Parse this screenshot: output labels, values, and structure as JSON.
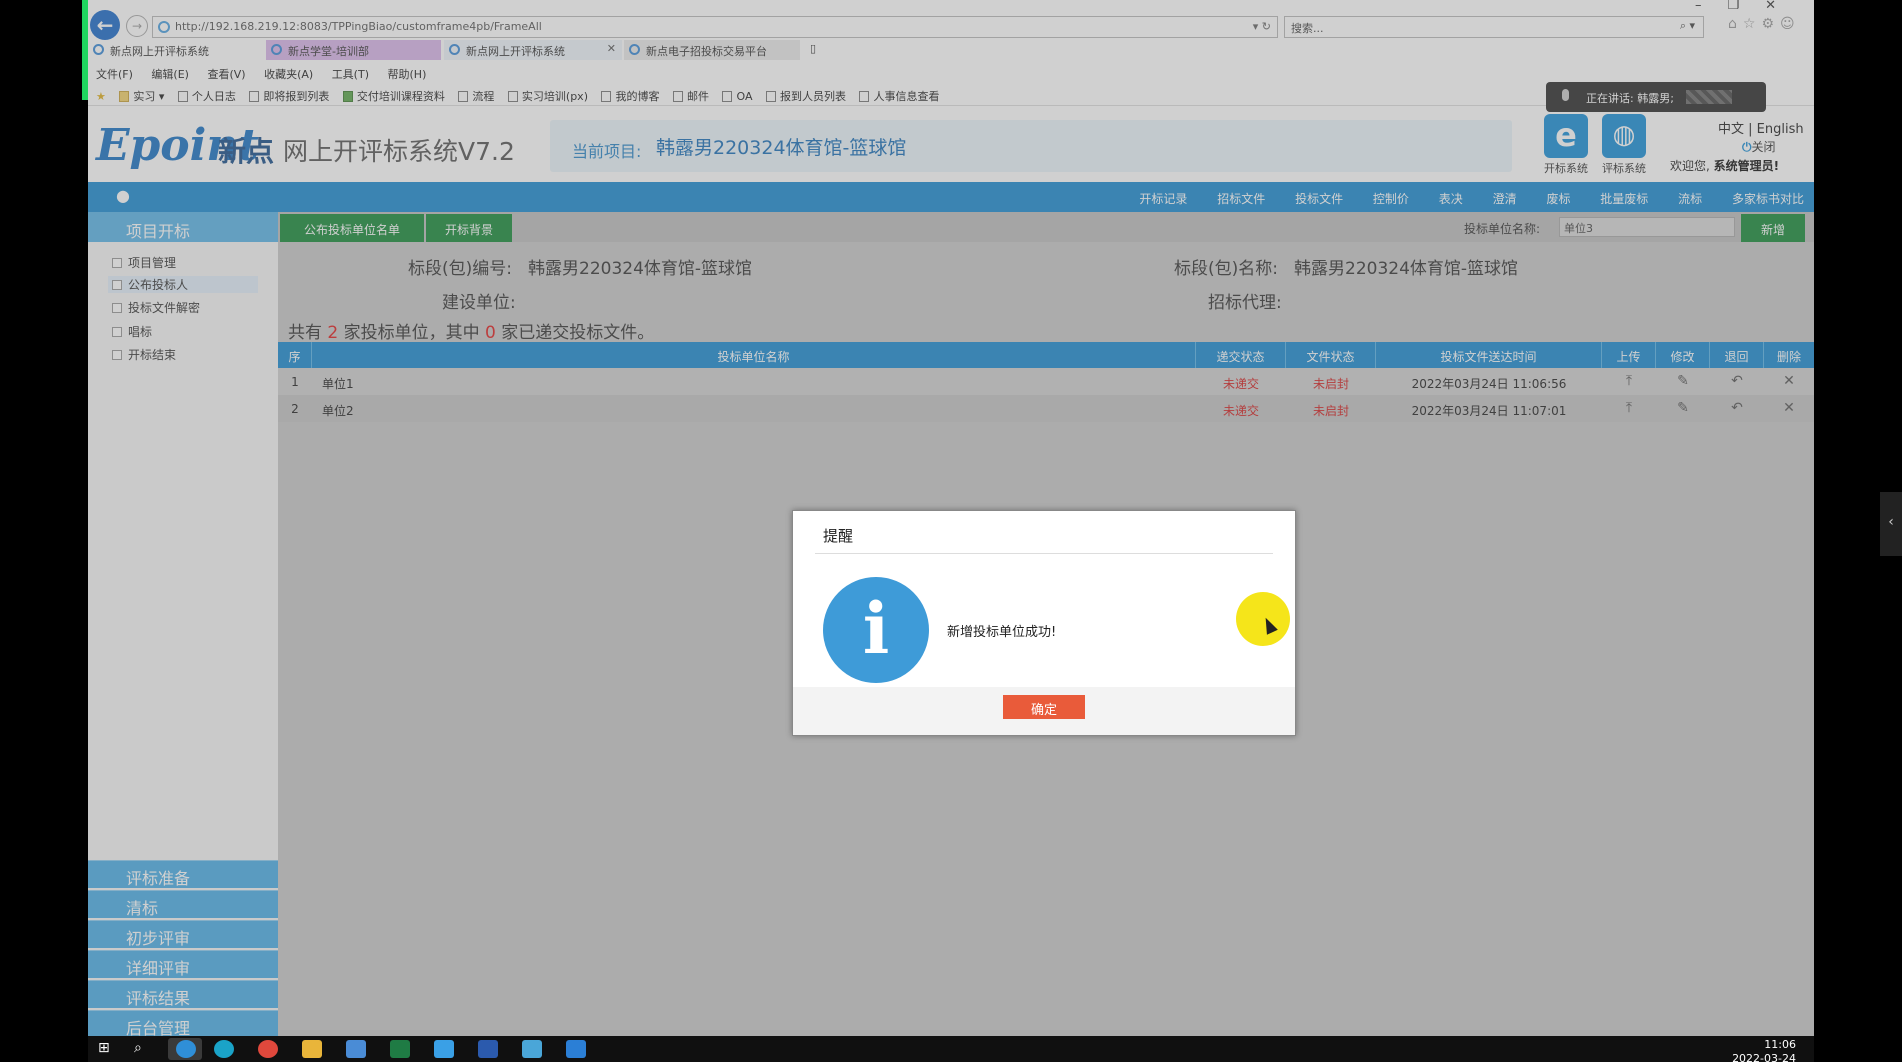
{
  "browser": {
    "url": "http://192.168.219.12:8083/TPPingBiao/customframe4pb/FrameAll",
    "search_placeholder": "搜索...",
    "tabs": [
      "新点网上开评标系统",
      "新点学堂-培训部",
      "新点网上开评标系统",
      "新点电子招投标交易平台"
    ],
    "menu": [
      "文件(F)",
      "编辑(E)",
      "查看(V)",
      "收藏夹(A)",
      "工具(T)",
      "帮助(H)"
    ],
    "favorites": [
      "实习",
      "个人日志",
      "即将报到列表",
      "交付培训课程资料",
      "流程",
      "实习培训(px)",
      "我的博客",
      "邮件",
      "OA",
      "报到人员列表",
      "人事信息查看"
    ],
    "speaking": "正在讲话: 韩露男;"
  },
  "header": {
    "logo_en": "Epoint",
    "logo_cn": "新点",
    "system_name": "网上开评标系统V7.2",
    "project_label": "当前项目:",
    "project_name": "韩露男220324体育馆-篮球馆",
    "sys_open": "开标系统",
    "sys_eval": "评标系统",
    "lang": "中文 | English",
    "close": "关闭",
    "welcome_prefix": "欢迎您,",
    "welcome_user": "系统管理员!"
  },
  "nav": [
    "开标记录",
    "招标文件",
    "投标文件",
    "控制价",
    "表决",
    "澄清",
    "废标",
    "批量废标",
    "流标",
    "多家标书对比"
  ],
  "sidebar": {
    "head": "项目开标",
    "items": [
      "项目管理",
      "公布投标人",
      "投标文件解密",
      "唱标",
      "开标结束"
    ],
    "sections": [
      "评标准备",
      "清标",
      "初步评审",
      "详细评审",
      "评标结果",
      "后台管理"
    ]
  },
  "toolbar": {
    "tab1": "公布投标单位名单",
    "tab2": "开标背景",
    "unit_label": "投标单位名称:",
    "unit_value": "单位3",
    "add": "新增"
  },
  "info": {
    "code_label": "标段(包)编号:",
    "code_value": "韩露男220324体育馆-篮球馆",
    "name_label": "标段(包)名称:",
    "name_value": "韩露男220324体育馆-篮球馆",
    "builder_label": "建设单位:",
    "agent_label": "招标代理:",
    "summary_a": "共有",
    "summary_total": "2",
    "summary_b": "家投标单位，其中",
    "summary_submitted": "0",
    "summary_c": "家已递交投标文件。"
  },
  "grid": {
    "headers": [
      "序",
      "投标单位名称",
      "递交状态",
      "文件状态",
      "投标文件送达时间",
      "上传",
      "修改",
      "退回",
      "删除"
    ],
    "rows": [
      {
        "no": "1",
        "name": "单位1",
        "submit": "未递交",
        "file": "未启封",
        "time": "2022年03月24日 11:06:56"
      },
      {
        "no": "2",
        "name": "单位2",
        "submit": "未递交",
        "file": "未启封",
        "time": "2022年03月24日 11:07:01"
      }
    ]
  },
  "dialog": {
    "title": "提醒",
    "message": "新增投标单位成功!",
    "ok": "确定"
  },
  "taskbar": {
    "time": "11:06",
    "date": "2022-03-24"
  }
}
